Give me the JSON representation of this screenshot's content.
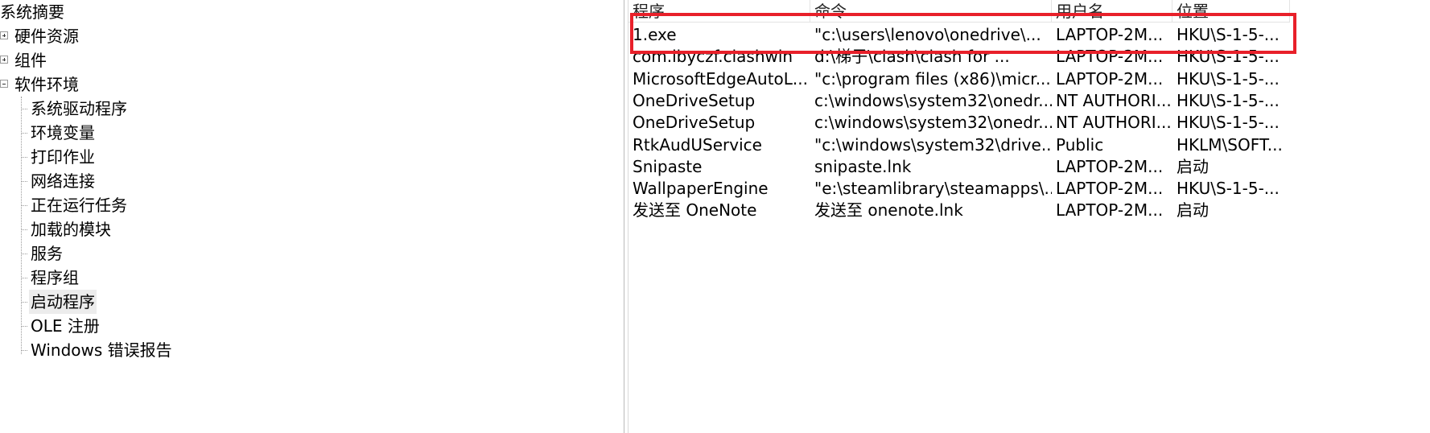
{
  "tree": {
    "root_label": "系统摘要",
    "nodes": [
      {
        "label": "硬件资源",
        "expander": "plus"
      },
      {
        "label": "组件",
        "expander": "plus"
      },
      {
        "label": "软件环境",
        "expander": "minus"
      }
    ],
    "software_children": [
      "系统驱动程序",
      "环境变量",
      "打印作业",
      "网络连接",
      "正在运行任务",
      "加载的模块",
      "服务",
      "程序组",
      "启动程序",
      "OLE 注册",
      "Windows 错误报告"
    ],
    "selected_child": "启动程序"
  },
  "list": {
    "columns": [
      "程序",
      "命令",
      "用户名",
      "位置"
    ],
    "rows": [
      {
        "program": "1.exe",
        "command": "\"c:\\users\\lenovo\\onedrive\\...",
        "user": "LAPTOP-2M...",
        "location": "HKU\\S-1-5-..."
      },
      {
        "program": "com.lbyczf.clashwin",
        "command": "d:\\梯子\\clash\\clash for ...",
        "user": "LAPTOP-2M...",
        "location": "HKU\\S-1-5-..."
      },
      {
        "program": "MicrosoftEdgeAutoL...",
        "command": "\"c:\\program files (x86)\\micr...",
        "user": "LAPTOP-2M...",
        "location": "HKU\\S-1-5-..."
      },
      {
        "program": "OneDriveSetup",
        "command": "c:\\windows\\system32\\onedr...",
        "user": "NT AUTHORI...",
        "location": "HKU\\S-1-5-..."
      },
      {
        "program": "OneDriveSetup",
        "command": "c:\\windows\\system32\\onedr...",
        "user": "NT AUTHORI...",
        "location": "HKU\\S-1-5-..."
      },
      {
        "program": "RtkAudUService",
        "command": "\"c:\\windows\\system32\\drive...",
        "user": "Public",
        "location": "HKLM\\SOFT..."
      },
      {
        "program": "Snipaste",
        "command": "snipaste.lnk",
        "user": "LAPTOP-2M...",
        "location": "启动"
      },
      {
        "program": "WallpaperEngine",
        "command": "\"e:\\steamlibrary\\steamapps\\...",
        "user": "LAPTOP-2M...",
        "location": "HKU\\S-1-5-..."
      },
      {
        "program": "发送至 OneNote",
        "command": "发送至 onenote.lnk",
        "user": "LAPTOP-2M...",
        "location": "启动"
      }
    ]
  },
  "annotation": {
    "highlight_color": "#e8202a"
  }
}
